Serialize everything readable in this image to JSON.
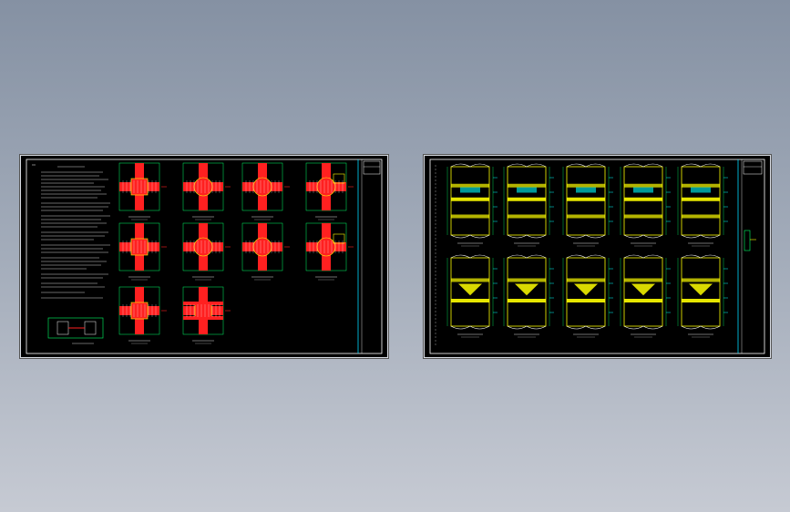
{
  "viewer": {
    "background_top": "#8591a3",
    "background_bottom": "#c6cad3"
  },
  "sheets": [
    {
      "name": "column-joint-detail-sheet",
      "colors": {
        "frame": "#ffffff",
        "border_line": "#00d8ff",
        "rebar": "#ff2020",
        "dim": "#00ff66",
        "text": "#e0e0e0"
      },
      "details_rows": 3
    },
    {
      "name": "beam-section-detail-sheet",
      "colors": {
        "frame": "#ffffff",
        "border_line": "#00d8ff",
        "section": "#ffff00",
        "dim": "#00ff66",
        "accent": "#00ffff"
      },
      "details_rows": 2
    }
  ]
}
